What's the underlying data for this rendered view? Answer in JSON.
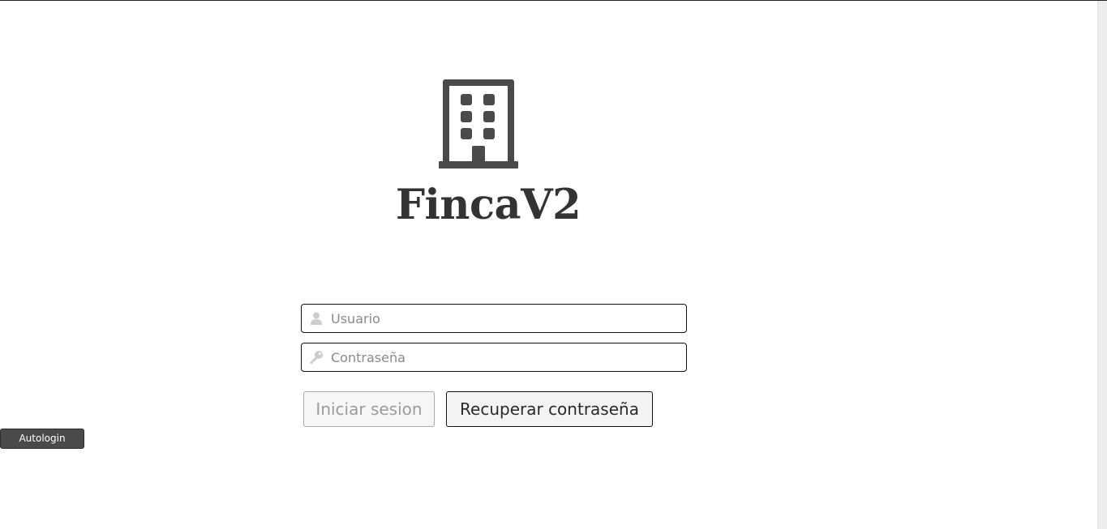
{
  "app": {
    "title": "FincaV2",
    "logo_icon": "building-icon"
  },
  "login_form": {
    "username": {
      "placeholder": "Usuario",
      "value": "",
      "icon": "user-icon"
    },
    "password": {
      "placeholder": "Contraseña",
      "value": "",
      "icon": "key-icon"
    },
    "login_button_label": "Iniciar sesion",
    "recover_button_label": "Recuperar contraseña"
  },
  "dev_tools": {
    "autologin_label": "Autologin"
  },
  "colors": {
    "text": "#333333",
    "icon": "#4a4a4a",
    "field_icon": "#cccccc",
    "disabled_text": "#9b9b9b",
    "autologin_bg": "#4a4a4a"
  }
}
